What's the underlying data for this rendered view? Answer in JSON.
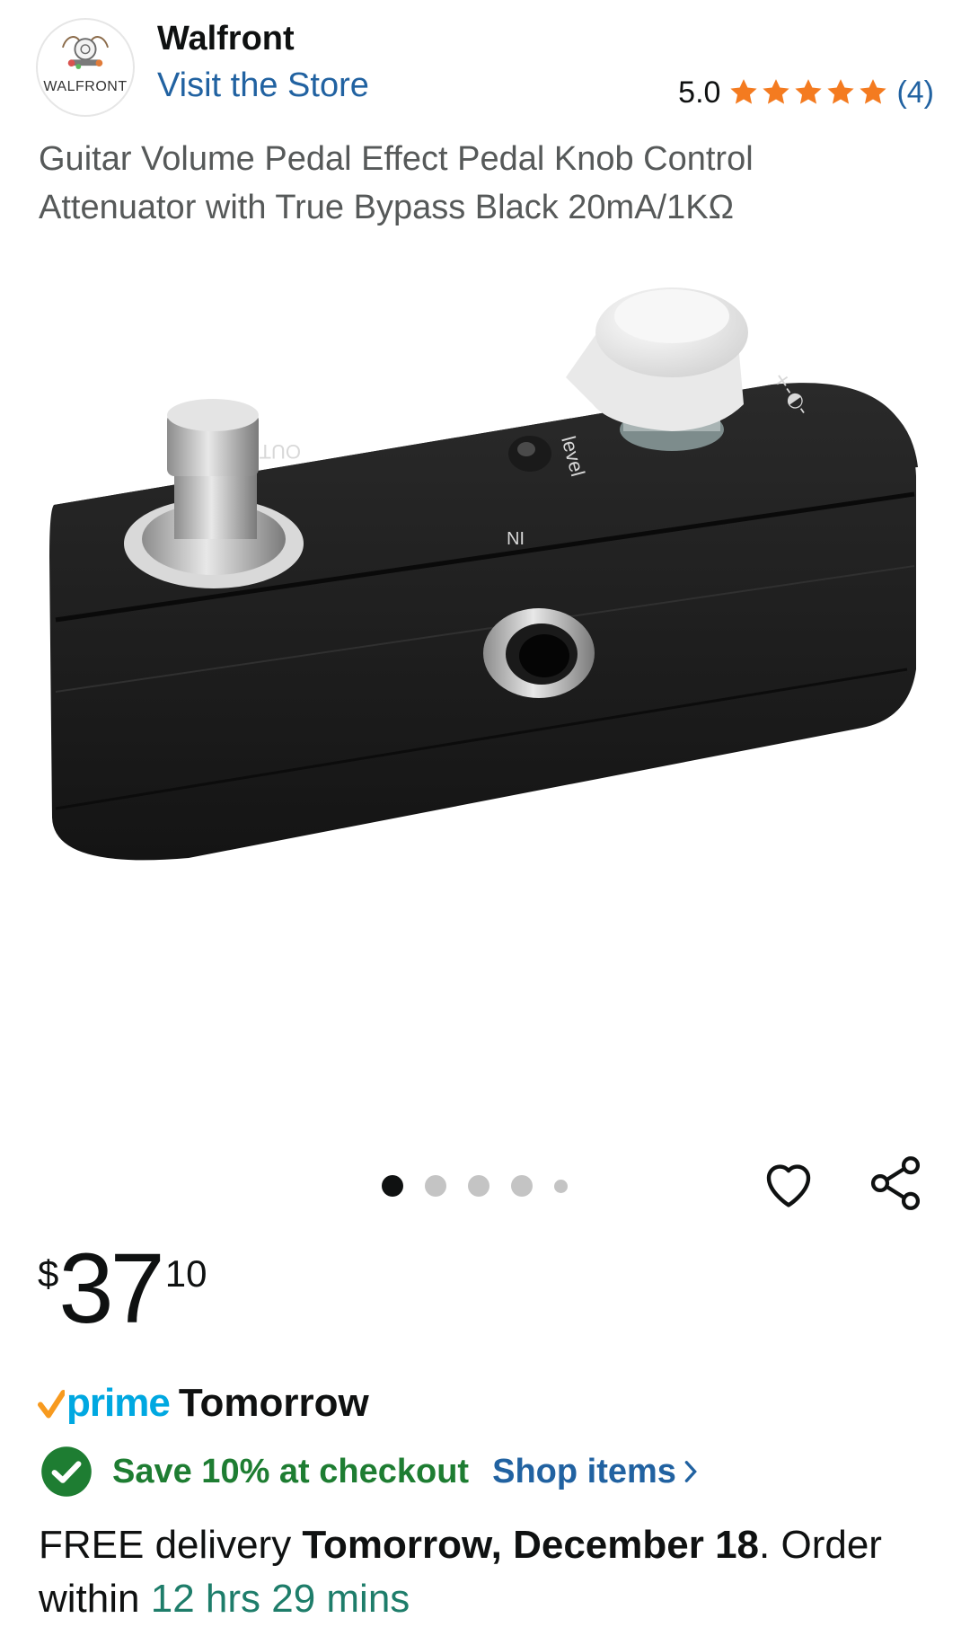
{
  "store": {
    "logo_text": "WALFRONT",
    "name": "Walfront",
    "visit_label": "Visit the Store"
  },
  "rating": {
    "value": "5.0",
    "stars": 5,
    "count_label": "(4)",
    "star_color": "#f47b20"
  },
  "product": {
    "title": "Guitar Volume Pedal Effect Pedal Knob Control Attenuator with True Bypass Black 20mA/1KΩ",
    "image_labels": {
      "out": "OUT",
      "in": "IN",
      "level": "level",
      "power": "+-◐-"
    }
  },
  "carousel": {
    "count": 5,
    "active_index": 0
  },
  "actions": {
    "wishlist_icon": "heart-icon",
    "share_icon": "share-icon"
  },
  "price": {
    "symbol": "$",
    "whole": "37",
    "fraction": "10"
  },
  "prime": {
    "label": "prime",
    "delivery_day": "Tomorrow",
    "brand_color": "#00a8e1",
    "check_color": "#f79a1f"
  },
  "promo": {
    "text": "Save 10% at checkout",
    "link_label": "Shop items",
    "color": "#1e7d32"
  },
  "delivery": {
    "prefix": "FREE delivery ",
    "date": "Tomorrow, December 18",
    "middle": ". Order within ",
    "countdown": "12 hrs 29 mins"
  }
}
